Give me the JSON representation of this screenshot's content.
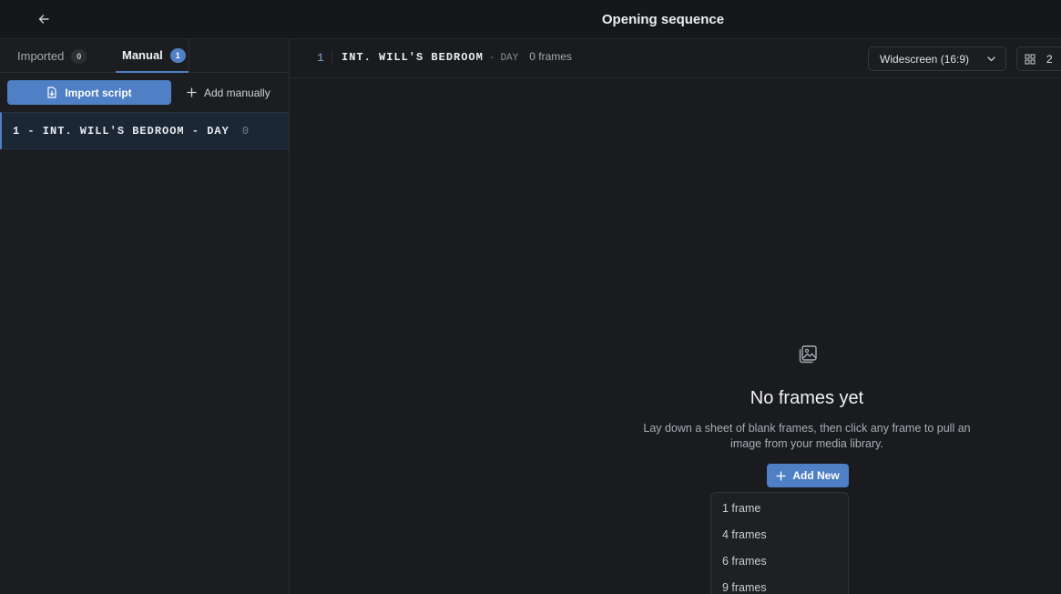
{
  "header": {
    "title": "Opening sequence",
    "back_icon": "arrow-left-icon"
  },
  "sidebar": {
    "tabs": [
      {
        "label": "Imported",
        "count": "0"
      },
      {
        "label": "Manual",
        "count": "1",
        "active": true
      }
    ],
    "import_button": {
      "label": "Import script",
      "icon": "file-import-icon"
    },
    "add_manually_button": {
      "label": "Add manually",
      "icon": "plus-icon"
    },
    "scenes": [
      {
        "heading": "1 - INT. WILL'S BEDROOM - DAY",
        "count": "0"
      }
    ]
  },
  "scene_bar": {
    "number": "1",
    "location": "INT. WILL'S BEDROOM",
    "separator": "-",
    "time": "DAY",
    "frames": "0 frames"
  },
  "aspect_select": {
    "value": "Widescreen (16:9)",
    "icon": "chevron-down-icon"
  },
  "grid_select": {
    "value": "2",
    "icon": "grid-icon"
  },
  "empty_state": {
    "icon": "images-icon",
    "title": "No frames yet",
    "description": "Lay down a sheet of blank frames, then click any frame to pull an image from your media library.",
    "add_button": "Add New"
  },
  "add_menu": {
    "items": [
      "1 frame",
      "4 frames",
      "6 frames",
      "9 frames"
    ]
  },
  "colors": {
    "accent": "#4f7fc4",
    "background": "#1a1b1f",
    "sidebar": "#1c1d21",
    "selected_scene": "#1c2736"
  }
}
